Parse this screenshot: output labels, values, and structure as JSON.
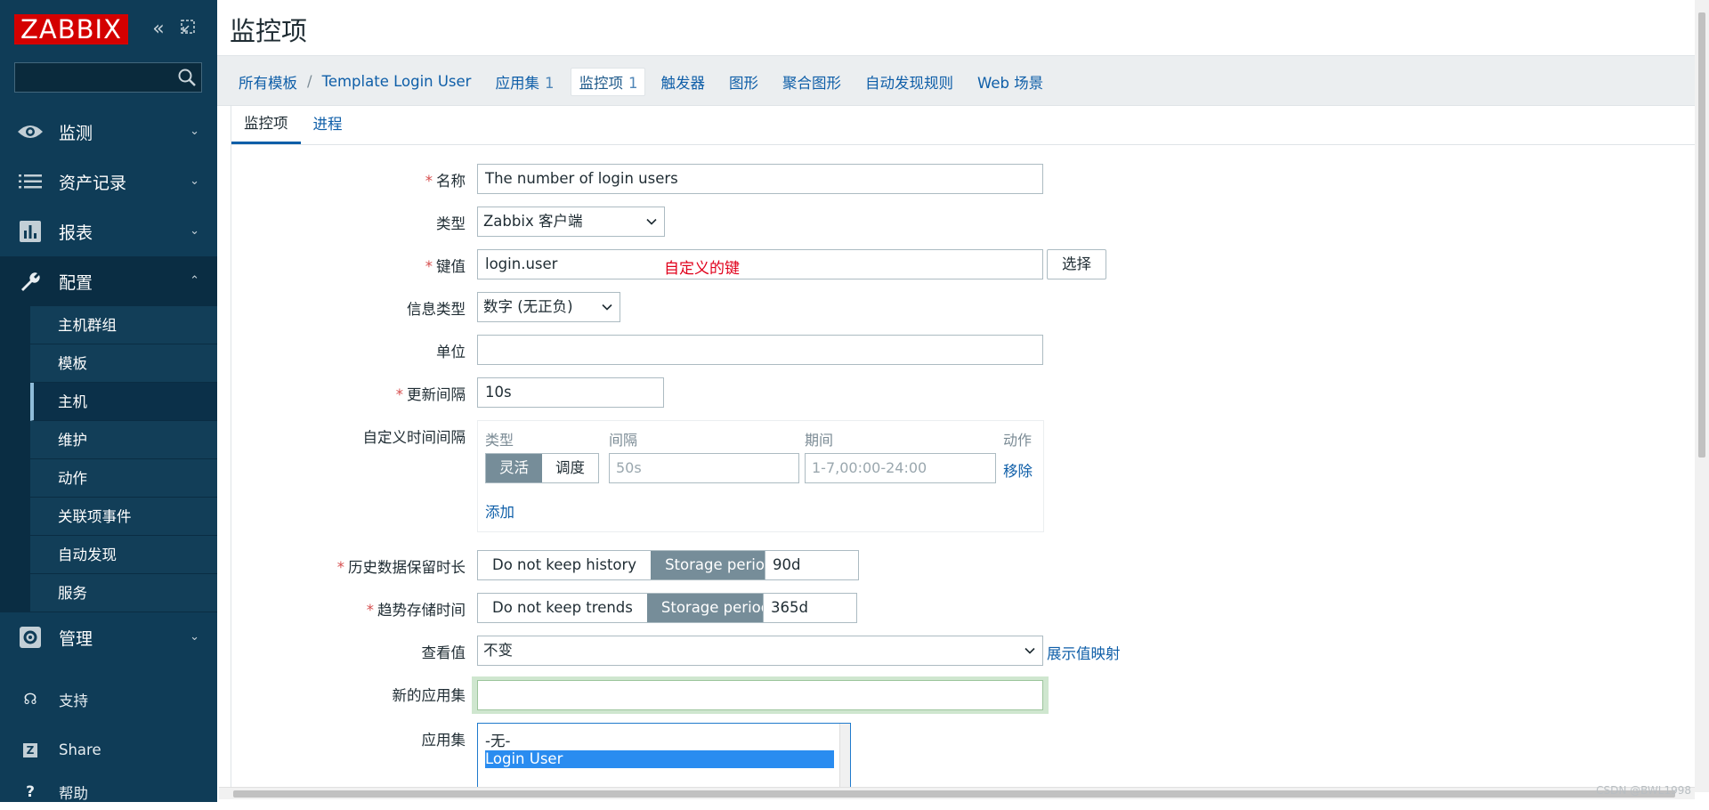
{
  "sidebar": {
    "logo": "ZABBIX",
    "search_placeholder": "",
    "menu": [
      {
        "label": "监测",
        "icon": "eye-icon"
      },
      {
        "label": "资产记录",
        "icon": "list-icon"
      },
      {
        "label": "报表",
        "icon": "bar-chart-icon"
      },
      {
        "label": "配置",
        "icon": "wrench-icon"
      }
    ],
    "config_submenu": [
      "主机群组",
      "模板",
      "主机",
      "维护",
      "动作",
      "关联项事件",
      "自动发现",
      "服务"
    ],
    "admin": {
      "label": "管理",
      "icon": "gear-icon"
    },
    "footer": [
      {
        "label": "支持",
        "icon": "headset-icon"
      },
      {
        "label": "Share",
        "icon": "zabbix-share-icon"
      },
      {
        "label": "帮助",
        "icon": "help-icon"
      }
    ]
  },
  "header": {
    "title": "监控项"
  },
  "breadcrumbs": {
    "all_templates": "所有模板",
    "separator": "/",
    "template": "Template Login User",
    "tabs": [
      {
        "label": "应用集",
        "count": "1"
      },
      {
        "label": "监控项",
        "count": "1"
      },
      {
        "label": "触发器",
        "count": ""
      },
      {
        "label": "图形",
        "count": ""
      },
      {
        "label": "聚合图形",
        "count": ""
      },
      {
        "label": "自动发现规则",
        "count": ""
      },
      {
        "label": "Web 场景",
        "count": ""
      }
    ]
  },
  "subtabs": [
    "监控项",
    "进程"
  ],
  "form": {
    "name": {
      "label": "名称",
      "value": "The number of login users"
    },
    "type": {
      "label": "类型",
      "value": "Zabbix 客户端"
    },
    "key": {
      "label": "键值",
      "value": "login.user",
      "annotation": "自定义的键",
      "select_button": "选择"
    },
    "info_type": {
      "label": "信息类型",
      "value": "数字 (无正负)"
    },
    "units": {
      "label": "单位",
      "value": ""
    },
    "update_interval": {
      "label": "更新间隔",
      "value": "10s"
    },
    "custom_intervals": {
      "label": "自定义时间间隔",
      "headers": {
        "type": "类型",
        "interval": "间隔",
        "period": "期间",
        "action": "动作"
      },
      "type_options": [
        "灵活",
        "调度"
      ],
      "interval_placeholder": "50s",
      "period_placeholder": "1-7,00:00-24:00",
      "remove": "移除",
      "add": "添加"
    },
    "history": {
      "label": "历史数据保留时长",
      "option_off": "Do not keep history",
      "option_on": "Storage period",
      "value": "90d"
    },
    "trends": {
      "label": "趋势存储时间",
      "option_off": "Do not keep trends",
      "option_on": "Storage period",
      "value": "365d"
    },
    "show_value": {
      "label": "查看值",
      "value": "不变",
      "link": "展示值映射"
    },
    "new_application": {
      "label": "新的应用集",
      "value": ""
    },
    "applications": {
      "label": "应用集",
      "options": [
        "-无-",
        "Login User"
      ],
      "selected": "Login User"
    }
  },
  "watermark": "CSDN @BWL1998"
}
